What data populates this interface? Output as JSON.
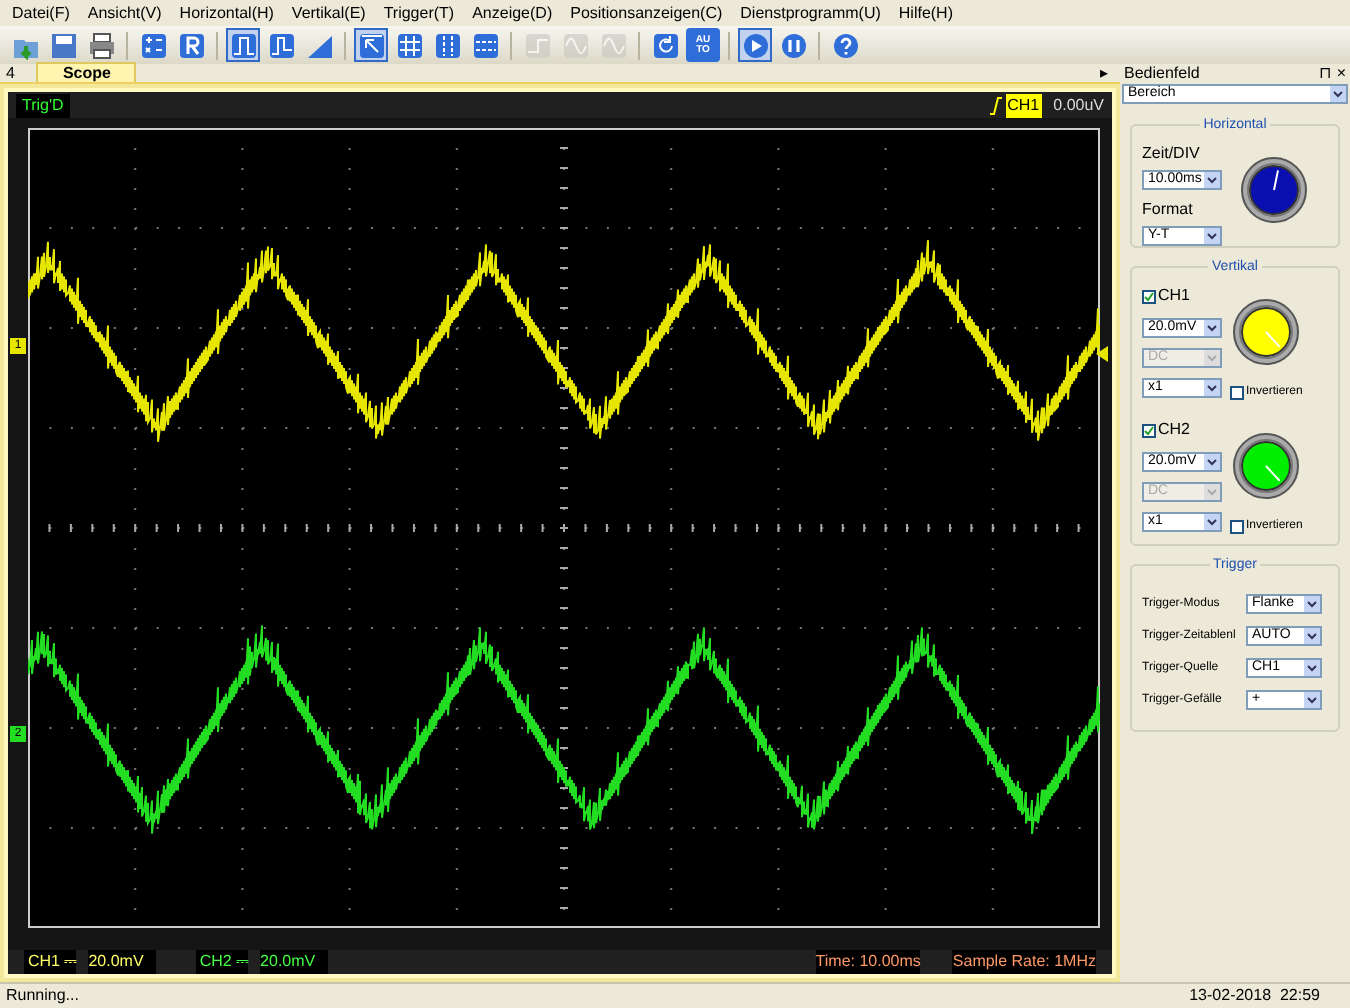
{
  "menu": [
    "Datei(F)",
    "Ansicht(V)",
    "Horizontal(H)",
    "Vertikal(E)",
    "Trigger(T)",
    "Anzeige(D)",
    "Positionsanzeigen(C)",
    "Dienstprogramm(U)",
    "Hilfe(H)"
  ],
  "toolbar": [
    {
      "kind": "open",
      "pressed": false,
      "disabled": false
    },
    {
      "kind": "save",
      "pressed": false,
      "disabled": false
    },
    {
      "kind": "print",
      "pressed": false,
      "disabled": false
    },
    {
      "kind": "sep"
    },
    {
      "kind": "math",
      "pressed": false,
      "disabled": false
    },
    {
      "kind": "ref",
      "pressed": false,
      "disabled": false
    },
    {
      "kind": "sep"
    },
    {
      "kind": "pulse",
      "pressed": true,
      "disabled": false
    },
    {
      "kind": "pulse2",
      "pressed": false,
      "disabled": false
    },
    {
      "kind": "ramp",
      "pressed": false,
      "disabled": false
    },
    {
      "kind": "sep"
    },
    {
      "kind": "cursor",
      "pressed": true,
      "disabled": false
    },
    {
      "kind": "grid",
      "pressed": false,
      "disabled": false
    },
    {
      "kind": "vlines",
      "pressed": false,
      "disabled": false
    },
    {
      "kind": "hlines",
      "pressed": false,
      "disabled": false
    },
    {
      "kind": "sep"
    },
    {
      "kind": "step",
      "pressed": false,
      "disabled": true
    },
    {
      "kind": "wave",
      "pressed": false,
      "disabled": true
    },
    {
      "kind": "wave",
      "pressed": false,
      "disabled": true
    },
    {
      "kind": "sep"
    },
    {
      "kind": "refresh",
      "pressed": false,
      "disabled": false
    },
    {
      "kind": "auto",
      "pressed": false,
      "disabled": false,
      "label": "AU TO"
    },
    {
      "kind": "sep"
    },
    {
      "kind": "play",
      "pressed": true,
      "disabled": false
    },
    {
      "kind": "pause",
      "pressed": false,
      "disabled": false
    },
    {
      "kind": "sep"
    },
    {
      "kind": "help",
      "pressed": false,
      "disabled": false
    }
  ],
  "tabs": {
    "left_arrow": "4",
    "items": [
      {
        "label": "Scope",
        "selected": true
      }
    ],
    "right_arrow": "▸"
  },
  "scope": {
    "status": "Trig'D",
    "trigger_channel": "CH1",
    "trigger_level": "0.00uV",
    "markers": [
      {
        "label": "1",
        "color": "#e6e600"
      },
      {
        "label": "2",
        "color": "#22dd22"
      }
    ],
    "footer": {
      "ch1_label": "CH1 ⎓",
      "ch1_value": "20.0mV",
      "ch2_label": "CH2 ⎓",
      "ch2_value": "20.0mV",
      "time": "Time: 10.00ms",
      "sample_rate": "Sample Rate: 1MHz"
    }
  },
  "panel": {
    "title": "Bedienfeld",
    "pin": "⊓",
    "close": "×",
    "dropdown": "Bereich",
    "horizontal": {
      "title": "Horizontal",
      "timediv_label": "Zeit/DIV",
      "timediv": "10.00ms",
      "format_label": "Format",
      "format": "Y-T"
    },
    "vertical": {
      "title": "Vertikal",
      "channels": [
        {
          "name": "CH1",
          "checked": true,
          "volts": "20.0mV",
          "coupling": "DC",
          "coupling_disabled": true,
          "probe": "x1",
          "invert_label": "Invertieren",
          "inverted": false,
          "color": "#ffff00"
        },
        {
          "name": "CH2",
          "checked": true,
          "volts": "20.0mV",
          "coupling": "DC",
          "coupling_disabled": true,
          "probe": "x1",
          "invert_label": "Invertieren",
          "inverted": false,
          "color": "#00ee00"
        }
      ]
    },
    "trigger": {
      "title": "Trigger",
      "rows": [
        {
          "label": "Trigger-Modus",
          "value": "Flanke"
        },
        {
          "label": "Trigger-Zeitablenl",
          "value": "AUTO"
        },
        {
          "label": "Trigger-Quelle",
          "value": "CH1"
        },
        {
          "label": "Trigger-Gefälle",
          "value": "+"
        }
      ]
    }
  },
  "status_bar": {
    "message": "Running...",
    "datetime": "13-02-2018  22:59"
  }
}
